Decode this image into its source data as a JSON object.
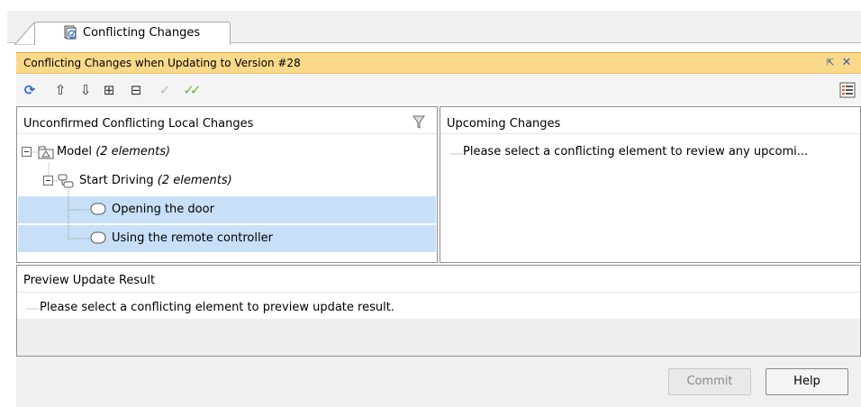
{
  "tab": {
    "label": "Conflicting Changes"
  },
  "window": {
    "title": "Conflicting Changes when Updating to Version #28"
  },
  "toolbar": {
    "buttons": [
      {
        "icon": "refresh-icon",
        "glyph": "⟳"
      },
      {
        "icon": "previous-change-icon",
        "glyph": "⇧"
      },
      {
        "icon": "next-change-icon",
        "glyph": "⇩"
      },
      {
        "icon": "expand-all-icon",
        "glyph": "⊞"
      },
      {
        "icon": "collapse-all-icon",
        "glyph": "⊟"
      },
      {
        "icon": "confirm-icon",
        "glyph": "✓"
      },
      {
        "icon": "confirm-all-icon",
        "glyph": "✓✓"
      }
    ]
  },
  "left_panel": {
    "header": "Unconfirmed Conflicting Local Changes",
    "tree": [
      {
        "label": "Model",
        "count": "(2 elements)"
      },
      {
        "label": "Start Driving",
        "count": "(2 elements)"
      },
      {
        "label": "Opening the door"
      },
      {
        "label": "Using the remote controller"
      }
    ]
  },
  "right_panel": {
    "header": "Upcoming Changes",
    "message": "Please select a conflicting element to review any upcomi..."
  },
  "preview": {
    "header": "Preview Update Result",
    "message": "Please select a conflicting element to preview update result."
  },
  "footer": {
    "commit_label": "Commit",
    "help_label": "Help"
  },
  "colors": {
    "title_bar": "#fbd98b",
    "selection": "#c7e0f7"
  }
}
